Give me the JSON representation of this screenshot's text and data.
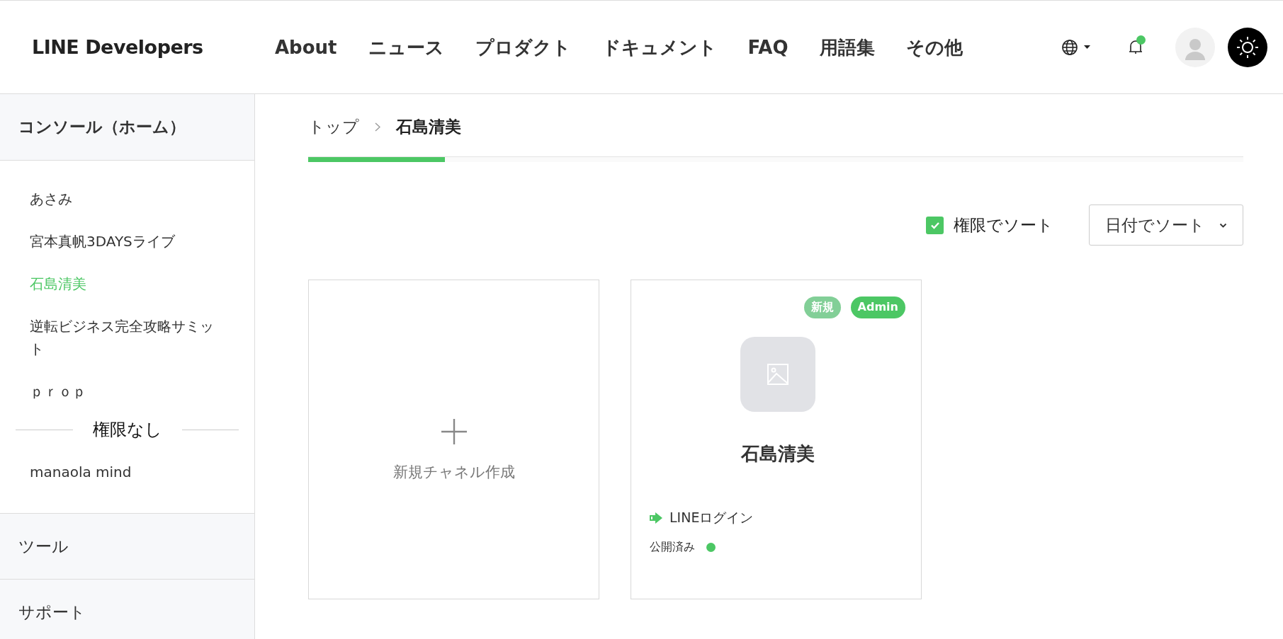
{
  "header": {
    "logo": "LINE Developers",
    "nav": [
      "About",
      "ニュース",
      "プロダクト",
      "ドキュメント",
      "FAQ",
      "用語集",
      "その他"
    ],
    "notification_dot": true
  },
  "sidebar": {
    "title": "コンソール（ホーム）",
    "items": [
      {
        "label": "あさみ",
        "selected": false
      },
      {
        "label": "宮本真帆3DAYSライブ",
        "selected": false
      },
      {
        "label": "石島清美",
        "selected": true
      },
      {
        "label": "逆転ビジネス完全攻略サミット",
        "selected": false
      },
      {
        "label": "ｐｒｏｐ",
        "selected": false
      }
    ],
    "divider": "権限なし",
    "other_items": [
      {
        "label": "manaola mind",
        "selected": false
      }
    ],
    "sections": [
      "ツール",
      "サポート"
    ]
  },
  "breadcrumb": [
    "トップ",
    "石島清美"
  ],
  "progress": {
    "level": 0.146
  },
  "sort": {
    "checkbox": {
      "label": "権限でソート",
      "checked": true
    },
    "dropdown": "日付でソート"
  },
  "new_card": {
    "label": "新規チャネル作成"
  },
  "channels": [
    {
      "name": "石島清美",
      "badges": [
        {
          "label": "新規",
          "kind": "new"
        },
        {
          "label": "Admin",
          "kind": "role"
        }
      ],
      "type": "LINEログイン",
      "status": "公開済み",
      "color": "#4cc764"
    }
  ]
}
